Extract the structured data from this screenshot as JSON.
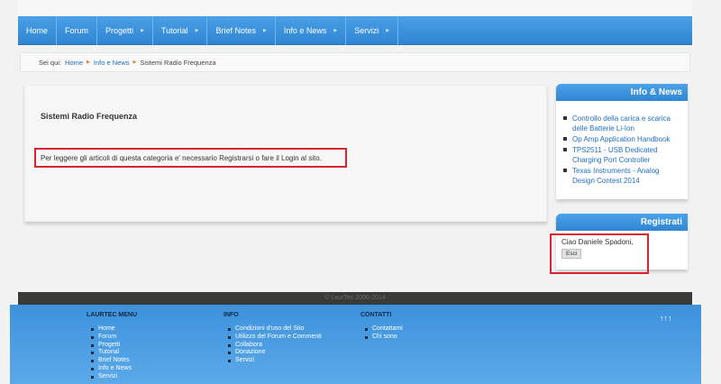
{
  "nav": {
    "items": [
      {
        "label": "Home",
        "has_submenu": false
      },
      {
        "label": "Forum",
        "has_submenu": false
      },
      {
        "label": "Progetti",
        "has_submenu": true
      },
      {
        "label": "Tutorial",
        "has_submenu": true
      },
      {
        "label": "Brief Notes",
        "has_submenu": true
      },
      {
        "label": "Info e News",
        "has_submenu": true
      },
      {
        "label": "Servizi",
        "has_submenu": true
      }
    ]
  },
  "breadcrumb": {
    "prefix": "Sei qui:",
    "items": [
      "Home",
      "Info e News",
      "Sistemi Radio Frequenza"
    ]
  },
  "content": {
    "title": "Sistemi Radio Frequenza",
    "notice": "Per leggere gli articoli di questa categoria e' necessario Registrarsi o fare il Login al sito."
  },
  "sidebar": {
    "news": {
      "title": "Info & News",
      "items": [
        "Controllo della carica e scarica delle Batterie Li-Ion",
        "Op Amp Application Handbook",
        "TPS2511 - USB Dedicated Charging Port Controller",
        "Texas Instruments - Analog Design Contest 2014"
      ]
    },
    "register": {
      "title": "Registrati",
      "greeting": "Ciao Daniele Spadoni,",
      "logout_label": "Esci"
    }
  },
  "copyright": "© LaurTec 2006-2014",
  "footer": {
    "columns": [
      {
        "title": "LAURTEC MENU",
        "items": [
          "Home",
          "Forum",
          "Progetti",
          "Tutorial",
          "Brief Notes",
          "Info e News",
          "Servizi"
        ]
      },
      {
        "title": "INFO",
        "items": [
          "Condizioni d'uso del Sito",
          "Utilizzo del Forum e Commenti",
          "Collabora",
          "Donazione",
          "Servizi"
        ]
      },
      {
        "title": "CONTATTI",
        "items": [
          "Contattami",
          "Chi sono"
        ]
      }
    ],
    "up_label": "↑↑↑"
  },
  "colors": {
    "accent": "#2f85d1",
    "link": "#1f6fc4",
    "highlight": "#d9232e"
  }
}
